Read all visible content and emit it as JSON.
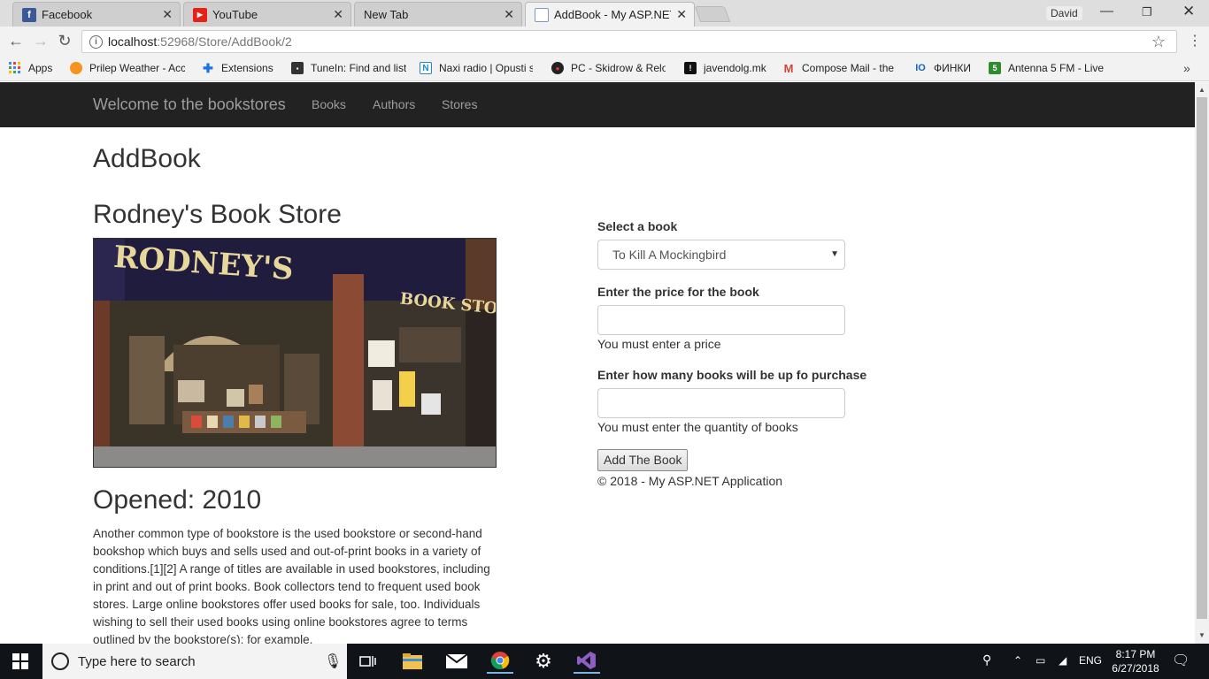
{
  "browser": {
    "tabs": [
      {
        "title": "Facebook",
        "icon": "facebook-icon"
      },
      {
        "title": "YouTube",
        "icon": "youtube-icon"
      },
      {
        "title": "New Tab",
        "icon": ""
      },
      {
        "title": "AddBook - My ASP.NET A",
        "icon": "page-icon"
      }
    ],
    "profile_name": "David",
    "url_host": "localhost",
    "url_path": ":52968/Store/AddBook/2",
    "bookmarks": [
      {
        "label": "Apps",
        "icon": "apps-grid-icon"
      },
      {
        "label": "Prilep Weather - Acc",
        "icon": "weather-icon"
      },
      {
        "label": "Extensions",
        "icon": "puzzle-icon"
      },
      {
        "label": "TuneIn: Find and list",
        "icon": "tunein-icon"
      },
      {
        "label": "Naxi radio | Opusti s",
        "icon": "naxi-icon"
      },
      {
        "label": "PC - Skidrow & Relo",
        "icon": "skidrow-icon"
      },
      {
        "label": "javendolg.mk",
        "icon": "javendolg-icon"
      },
      {
        "label": "Compose Mail - the",
        "icon": "gmail-icon"
      },
      {
        "label": "ФИНКИ",
        "icon": "finki-icon"
      },
      {
        "label": "Antenna 5 FM - Live",
        "icon": "antenna5-icon"
      }
    ],
    "colors": {
      "facebook": "#3b5998",
      "youtube": "#e62117",
      "gmail": "#d44638",
      "vs": "#68217a"
    }
  },
  "site": {
    "brand": "Welcome to the bookstores",
    "nav": [
      "Books",
      "Authors",
      "Stores"
    ]
  },
  "page": {
    "heading": "AddBook",
    "store_name": "Rodney's Book Store",
    "photo_sign_main": "RODNEY'S",
    "photo_sign_side": "BOOK STORE",
    "opened": "Opened: 2010",
    "description": "Another common type of bookstore is the used bookstore or second-hand bookshop which buys and sells used and out-of-print books in a variety of conditions.[1][2] A range of titles are available in used bookstores, including in print and out of print books. Book collectors tend to frequent used book stores. Large online bookstores offer used books for sale, too. Individuals wishing to sell their used books using online bookstores agree to terms outlined by the bookstore(s); for example,"
  },
  "form": {
    "select_label": "Select a book",
    "select_value": "To Kill A Mockingbird",
    "price_label": "Enter the price for the book",
    "price_value": "",
    "price_error": "You must enter a price",
    "qty_label": "Enter how many books will be up fo purchase",
    "qty_value": "",
    "qty_error": "You must enter the quantity of books",
    "submit_label": "Add The Book",
    "footer": "© 2018 - My ASP.NET Application"
  },
  "taskbar": {
    "search_placeholder": "Type here to search",
    "language": "ENG",
    "time": "8:17 PM",
    "date": "6/27/2018"
  }
}
